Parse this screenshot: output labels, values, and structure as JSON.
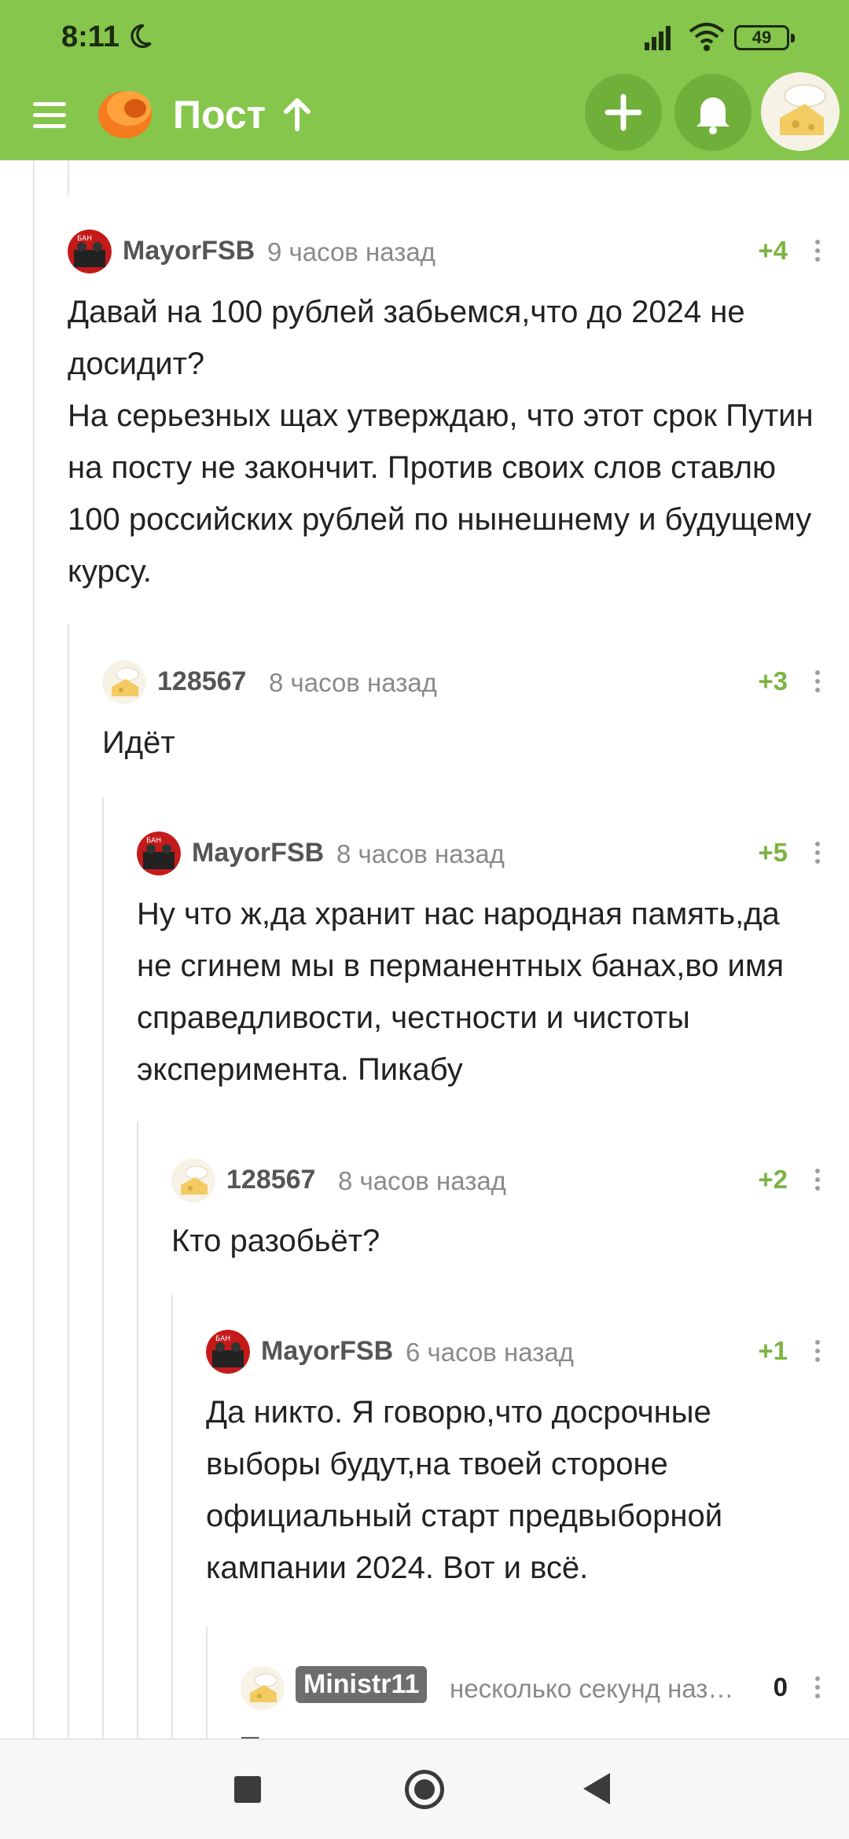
{
  "status_bar": {
    "time": "8:11",
    "battery": "49",
    "icons": [
      "moon-icon",
      "signal-icon",
      "wifi-icon",
      "battery-icon"
    ]
  },
  "app_bar": {
    "title": "Пост",
    "accent_color": "#86c64c",
    "icons": [
      "menu-icon",
      "pikabu-logo",
      "arrow-up-icon",
      "plus-icon",
      "bell-icon",
      "avatar"
    ]
  },
  "comments": [
    {
      "user": "MayorFSB",
      "time": "9 часов назад",
      "rating": "+4",
      "text": "Давай на 100 рублей забьемся,что до 2024 не досидит?\nНа серьезных щах утверждаю, что этот срок Путин на посту не закончит. Против своих слов ставлю 100 российских рублей по нынешнему и будущему курсу."
    },
    {
      "user": "128567",
      "time": "8 часов назад",
      "rating": "+3",
      "text": "Идёт"
    },
    {
      "user": "MayorFSB",
      "time": "8 часов назад",
      "rating": "+5",
      "text": "Ну что ж,да хранит нас народная память,да не сгинем мы в перманентных банах,во имя справедливости, честности и чистоты эксперимента. Пикабу"
    },
    {
      "user": "128567",
      "time": "8 часов назад",
      "rating": "+2",
      "text": "Кто разобьёт?"
    },
    {
      "user": "MayorFSB",
      "time": "6 часов назад",
      "rating": "+1",
      "text": "Да никто. Я говорю,что досрочные выборы будут,на твоей стороне официальный старт предвыборной кампании 2024. Вот и всё."
    },
    {
      "user": "Ministr11",
      "time": "несколько секунд наз…",
      "rating": "0",
      "text": "Т"
    }
  ],
  "colors": {
    "rating": "#7cb342",
    "username": "#555555",
    "timestamp": "#8a8a8a"
  },
  "nav_bar": {
    "icons": [
      "recents-icon",
      "home-icon",
      "back-icon"
    ]
  }
}
